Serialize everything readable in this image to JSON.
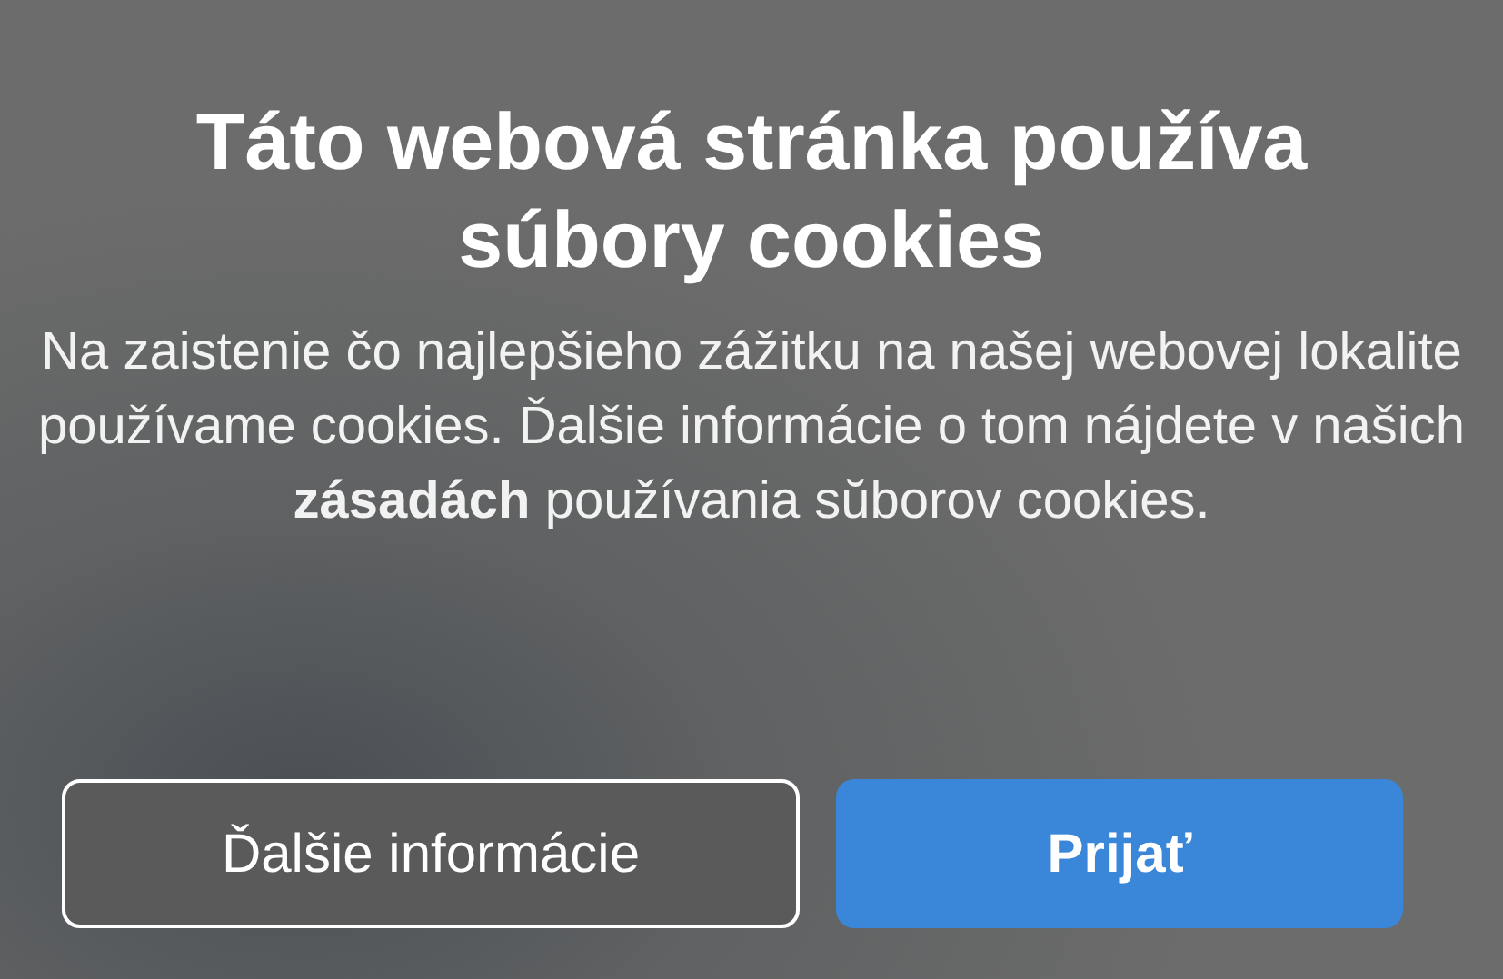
{
  "dialog": {
    "title": "Táto webová stránka používa súbory cookies",
    "message": "Na zaistenie čo najlepšieho zážitku na našej webovej lokalite používame cookies. Ďalšie informácie o tom nájdete v našich **zásadách** používania sŭborov cookies.",
    "buttons": [
      {
        "label": "Ďalšie informácie",
        "kind": "secondary"
      },
      {
        "label": "Prijať",
        "kind": "primary"
      }
    ]
  }
}
